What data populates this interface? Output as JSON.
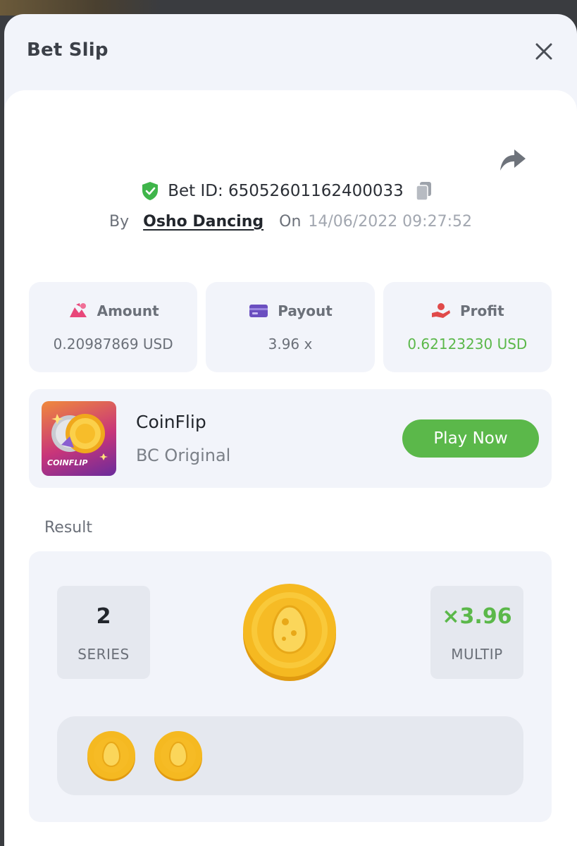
{
  "modal": {
    "title": "Bet Slip"
  },
  "bet": {
    "id_text": "Bet ID: 65052601162400033",
    "by_label": "By",
    "user_name": "Osho Dancing",
    "on_label": "On",
    "date": "14/06/2022 09:27:52"
  },
  "stats": [
    {
      "label": "Amount",
      "value": "0.20987869 USD",
      "icon": "amount-icon",
      "color": "#e8477a"
    },
    {
      "label": "Payout",
      "value": "3.96 x",
      "icon": "payout-card-icon",
      "color": "#6b4fc0"
    },
    {
      "label": "Profit",
      "value": "0.62123230 USD",
      "icon": "profit-hand-icon",
      "color": "#e04a4a"
    }
  ],
  "game": {
    "name": "CoinFlip",
    "provider": "BC Original",
    "thumb_label": "COINFLIP",
    "play_label": "Play Now"
  },
  "result": {
    "label": "Result",
    "series_value": "2",
    "series_label": "SERIES",
    "multip_value": "×3.96",
    "multip_label": "MULTIP",
    "history_count": 2
  },
  "colors": {
    "accent_green": "#5bb84a",
    "panel_bg": "#f2f4fa",
    "coin_gold": "#f5b921"
  }
}
